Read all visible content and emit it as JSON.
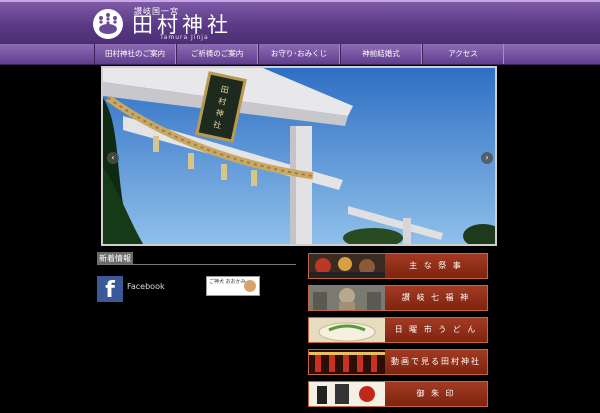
{
  "header": {
    "subtitle": "讃岐国一宮",
    "title": "田村神社",
    "romaji": "Tamura Jinja",
    "logo_icon": "kiri-crest-icon"
  },
  "nav": {
    "items": [
      {
        "label": "田村神社のご案内"
      },
      {
        "label": "ご祈祷のご案内"
      },
      {
        "label": "お守り･おみくじ"
      },
      {
        "label": "神前結婚式"
      },
      {
        "label": "アクセス"
      }
    ]
  },
  "slider": {
    "prev_icon": "chevron-left-icon",
    "next_icon": "chevron-right-icon",
    "plaque_text": "田村神社"
  },
  "news": {
    "label": "新着情報"
  },
  "facebook": {
    "icon_letter": "f",
    "label": "Facebook"
  },
  "omikuji": {
    "text": "ご神犬 おおかみ"
  },
  "banners": [
    {
      "label": "主 な 祭 事"
    },
    {
      "label": "讃 岐 七 福 神"
    },
    {
      "label": "日 曜 市 う ど ん"
    },
    {
      "label": "動画で見る田村神社"
    },
    {
      "label": "御 朱 印"
    }
  ],
  "colors": {
    "header_purple": "#6a4a96",
    "banner_red": "#8e2c16",
    "facebook_blue": "#3b5998"
  }
}
